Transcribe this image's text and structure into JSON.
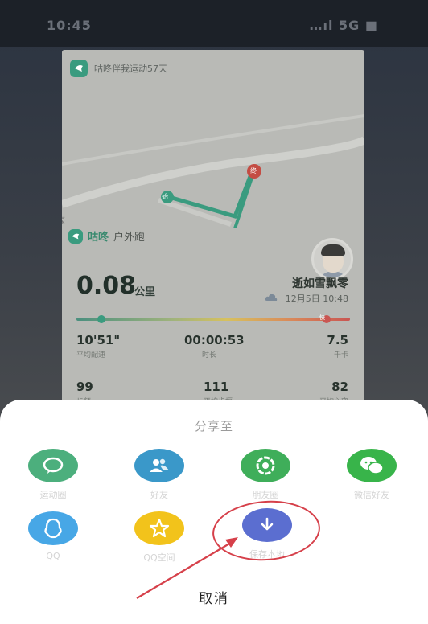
{
  "status_bar": {
    "time": "10:45",
    "right_text": "…ıl 5G ■"
  },
  "card": {
    "brand_text": "咕咚伴我运动57天",
    "map_end_label": "终",
    "map_start_label": "始",
    "map_side_label": "揼",
    "app_name": "咕咚",
    "activity": "户外跑",
    "distance": "0.08",
    "distance_unit": "公里",
    "user_name": "逝如雪飘零",
    "date": "12月5日 10:48",
    "bar_end_label": "快",
    "stats": [
      {
        "value": "10'51\"",
        "label": "平均配速"
      },
      {
        "value": "00:00:53",
        "label": "时长"
      },
      {
        "value": "7.5",
        "label": "千卡"
      },
      {
        "value": "99",
        "label": "步频"
      },
      {
        "value": "111",
        "label": "平均步幅"
      },
      {
        "value": "82",
        "label": "平均心率"
      }
    ]
  },
  "sheet": {
    "title": "分享至",
    "items": [
      {
        "label": "运动圈",
        "icon": "chat-bubble-icon",
        "color": "#4caf7d"
      },
      {
        "label": "好友",
        "icon": "friends-icon",
        "color": "#3a98c9"
      },
      {
        "label": "朋友圈",
        "icon": "moments-icon",
        "color": "#3fae5a"
      },
      {
        "label": "微信好友",
        "icon": "wechat-icon",
        "color": "#38b44a"
      },
      {
        "label": "QQ",
        "icon": "qq-icon",
        "color": "#47a7e6"
      },
      {
        "label": "QQ空间",
        "icon": "qzone-star-icon",
        "color": "#f2c31b"
      },
      {
        "label": "保存本地",
        "icon": "download-icon",
        "color": "#5b6ed0"
      }
    ],
    "cancel": "取消"
  },
  "colors": {
    "annotation": "#d6404a",
    "brand_green": "#3a9b7f"
  }
}
